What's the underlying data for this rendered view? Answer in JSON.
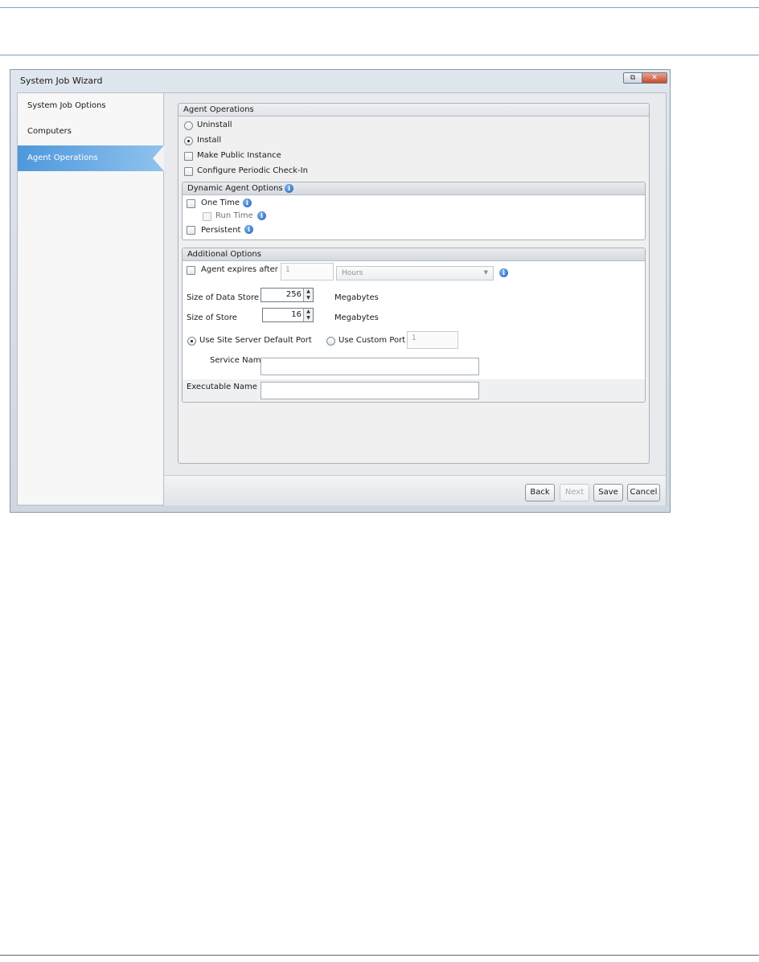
{
  "window": {
    "title": "System Job Wizard",
    "restore_glyph": "⧉",
    "close_glyph": "✕"
  },
  "sidebar": {
    "items": [
      {
        "label": "System Job Options",
        "active": false
      },
      {
        "label": "Computers",
        "active": false
      },
      {
        "label": "Agent Operations",
        "active": true
      }
    ]
  },
  "agent_operations": {
    "title": "Agent Operations",
    "uninstall_label": "Uninstall",
    "install_label": "Install",
    "selected": "Install",
    "make_public_label": "Make Public Instance",
    "make_public_checked": false,
    "periodic_checkin_label": "Configure Periodic Check-In",
    "periodic_checkin_checked": false
  },
  "dynamic_agent_options": {
    "title": "Dynamic Agent Options",
    "one_time_label": "One Time",
    "run_time_label": "Run Time",
    "persistent_label": "Persistent"
  },
  "additional_options": {
    "title": "Additional Options",
    "agent_expires_label": "Agent expires after",
    "agent_expires_value": "1",
    "expires_unit": "Hours",
    "data_store_label": "Size of Data Store",
    "data_store_value": "256",
    "data_store_unit": "Megabytes",
    "store_label": "Size of Store",
    "store_value": "16",
    "store_unit": "Megabytes",
    "default_port_label": "Use Site Server Default Port",
    "custom_port_label": "Use Custom Port",
    "custom_port_value": "1",
    "port_selected": "Use Site Server Default Port",
    "service_name_label": "Service Name",
    "service_name_value": "",
    "executable_name_label": "Executable Name",
    "executable_name_value": ""
  },
  "footer": {
    "back_label": "Back",
    "next_label": "Next",
    "save_label": "Save",
    "cancel_label": "Cancel"
  },
  "icons": {
    "info": "i"
  },
  "colors": {
    "sidebar_active": "#4e98dc",
    "info_icon": "#1f5fb8",
    "rule_lines": "#7ea2c4"
  }
}
